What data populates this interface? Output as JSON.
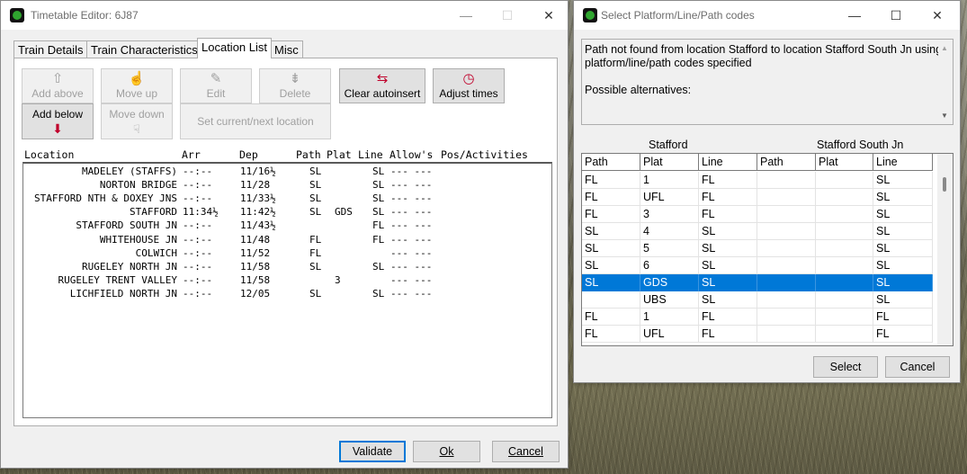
{
  "editor": {
    "title": "Timetable Editor: 6J87",
    "tabs": [
      "Train Details",
      "Train Characteristics",
      "Location List",
      "Misc"
    ],
    "selected_tab": "Location List",
    "buttons": {
      "add_above": "Add above",
      "move_up": "Move up",
      "edit": "Edit",
      "delete": "Delete",
      "clear_autoinsert": "Clear autoinsert",
      "adjust_times": "Adjust times",
      "add_below": "Add below",
      "move_down": "Move down",
      "set_current": "Set current/next location"
    },
    "columns": {
      "location": "Location",
      "arr": "Arr",
      "dep": "Dep",
      "path": "Path",
      "plat": "Plat",
      "line": "Line",
      "allows": "Allow's",
      "pos": "Pos/Activities"
    },
    "rows": [
      {
        "location": "MADELEY (STAFFS)",
        "arr": "--:--",
        "dep": "11/16½",
        "path": "SL",
        "plat": "",
        "line": "SL",
        "allows": "--- ---"
      },
      {
        "location": "NORTON BRIDGE",
        "arr": "--:--",
        "dep": "11/28",
        "path": "SL",
        "plat": "",
        "line": "SL",
        "allows": "--- ---"
      },
      {
        "location": "STAFFORD NTH & DOXEY JNS",
        "arr": "--:--",
        "dep": "11/33½",
        "path": "SL",
        "plat": "",
        "line": "SL",
        "allows": "--- ---"
      },
      {
        "location": "STAFFORD",
        "arr": "11:34½",
        "dep": "11:42½",
        "path": "SL",
        "plat": "GDS",
        "line": "SL",
        "allows": "--- ---"
      },
      {
        "location": "STAFFORD SOUTH JN",
        "arr": "--:--",
        "dep": "11/43½",
        "path": "",
        "plat": "",
        "line": "FL",
        "allows": "--- ---"
      },
      {
        "location": "WHITEHOUSE JN",
        "arr": "--:--",
        "dep": "11/48",
        "path": "FL",
        "plat": "",
        "line": "FL",
        "allows": "--- ---"
      },
      {
        "location": "COLWICH",
        "arr": "--:--",
        "dep": "11/52",
        "path": "FL",
        "plat": "",
        "line": "",
        "allows": "--- ---"
      },
      {
        "location": "RUGELEY NORTH JN",
        "arr": "--:--",
        "dep": "11/58",
        "path": "SL",
        "plat": "",
        "line": "SL",
        "allows": "--- ---"
      },
      {
        "location": "RUGELEY TRENT VALLEY",
        "arr": "--:--",
        "dep": "11/58",
        "path": "",
        "plat": "3",
        "line": "",
        "allows": "--- ---"
      },
      {
        "location": "LICHFIELD NORTH JN",
        "arr": "--:--",
        "dep": "12/05",
        "path": "SL",
        "plat": "",
        "line": "SL",
        "allows": "--- ---"
      }
    ],
    "footer": {
      "validate": "Validate",
      "ok": "Ok",
      "cancel": "Cancel"
    }
  },
  "selector": {
    "title": "Select Platform/Line/Path codes",
    "message_line1": "Path not found from location Stafford to location Stafford South Jn using",
    "message_line2": "platform/line/path codes specified",
    "message_line3": "Possible alternatives:",
    "group_from": "Stafford",
    "group_to": "Stafford South Jn",
    "columns": [
      "Path",
      "Plat",
      "Line",
      "Path",
      "Plat",
      "Line"
    ],
    "rows": [
      [
        "FL",
        "1",
        "FL",
        "",
        "",
        "SL"
      ],
      [
        "FL",
        "UFL",
        "FL",
        "",
        "",
        "SL"
      ],
      [
        "FL",
        "3",
        "FL",
        "",
        "",
        "SL"
      ],
      [
        "SL",
        "4",
        "SL",
        "",
        "",
        "SL"
      ],
      [
        "SL",
        "5",
        "SL",
        "",
        "",
        "SL"
      ],
      [
        "SL",
        "6",
        "SL",
        "",
        "",
        "SL"
      ],
      [
        "SL",
        "GDS",
        "SL",
        "",
        "",
        "SL"
      ],
      [
        "",
        "UBS",
        "SL",
        "",
        "",
        "SL"
      ],
      [
        "FL",
        "1",
        "FL",
        "",
        "",
        "FL"
      ],
      [
        "FL",
        "UFL",
        "FL",
        "",
        "",
        "FL"
      ]
    ],
    "selected_row": 6,
    "footer": {
      "select": "Select",
      "cancel": "Cancel"
    }
  },
  "window_controls": {
    "minimize": "—",
    "maximize": "☐",
    "close": "✕"
  },
  "colors": {
    "selection": "#0078d7",
    "window_bg": "#f0f0f0"
  }
}
